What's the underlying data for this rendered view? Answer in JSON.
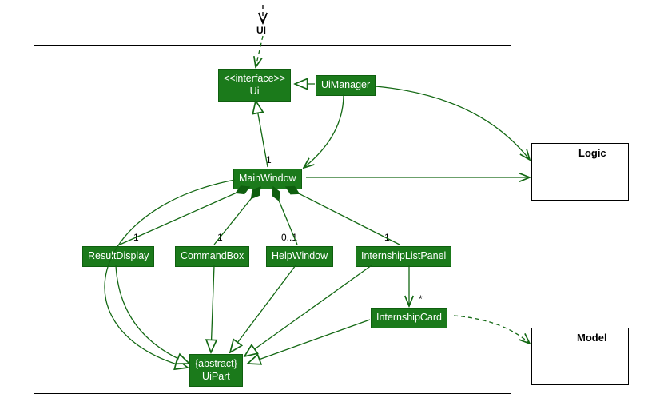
{
  "diagram": {
    "title": "UI",
    "boxes": {
      "ui_interface": {
        "line1": "<<interface>>",
        "line2": "Ui"
      },
      "ui_manager": "UiManager",
      "main_window": "MainWindow",
      "result_display": "ResultDisplay",
      "command_box": "CommandBox",
      "help_window": "HelpWindow",
      "internship_list_panel": "InternshipListPanel",
      "internship_card": "InternshipCard",
      "ui_part": {
        "line1": "{abstract}",
        "line2": "UiPart"
      }
    },
    "packages": {
      "logic": "Logic",
      "model": "Model"
    },
    "multiplicities": {
      "main_window_top": "1",
      "result_display": "1",
      "command_box": "1",
      "help_window": "0..1",
      "internship_list_panel": "1",
      "internship_card": "*"
    },
    "colors": {
      "box": "#1b7a1b",
      "stroke": "#136813"
    },
    "relations": [
      {
        "from": "UiManager",
        "to": "Ui",
        "type": "realization"
      },
      {
        "from": "MainWindow",
        "to": "Ui",
        "type": "realization"
      },
      {
        "from": "UiManager",
        "to": "MainWindow",
        "mult": "1",
        "type": "association"
      },
      {
        "from": "UiManager",
        "to": "Logic",
        "type": "association"
      },
      {
        "from": "MainWindow",
        "to": "Logic",
        "type": "association"
      },
      {
        "from": "MainWindow",
        "to": "ResultDisplay",
        "mult": "1",
        "type": "composition"
      },
      {
        "from": "MainWindow",
        "to": "CommandBox",
        "mult": "1",
        "type": "composition"
      },
      {
        "from": "MainWindow",
        "to": "HelpWindow",
        "mult": "0..1",
        "type": "composition"
      },
      {
        "from": "MainWindow",
        "to": "InternshipListPanel",
        "mult": "1",
        "type": "composition"
      },
      {
        "from": "InternshipListPanel",
        "to": "InternshipCard",
        "mult": "*",
        "type": "association"
      },
      {
        "from": "InternshipCard",
        "to": "Model",
        "type": "dependency"
      },
      {
        "from": "ResultDisplay",
        "to": "UiPart",
        "type": "generalization"
      },
      {
        "from": "CommandBox",
        "to": "UiPart",
        "type": "generalization"
      },
      {
        "from": "HelpWindow",
        "to": "UiPart",
        "type": "generalization"
      },
      {
        "from": "InternshipListPanel",
        "to": "UiPart",
        "type": "generalization"
      },
      {
        "from": "InternshipCard",
        "to": "UiPart",
        "type": "generalization"
      },
      {
        "from": "MainWindow",
        "to": "UiPart",
        "type": "generalization"
      }
    ],
    "chart_data": null
  }
}
